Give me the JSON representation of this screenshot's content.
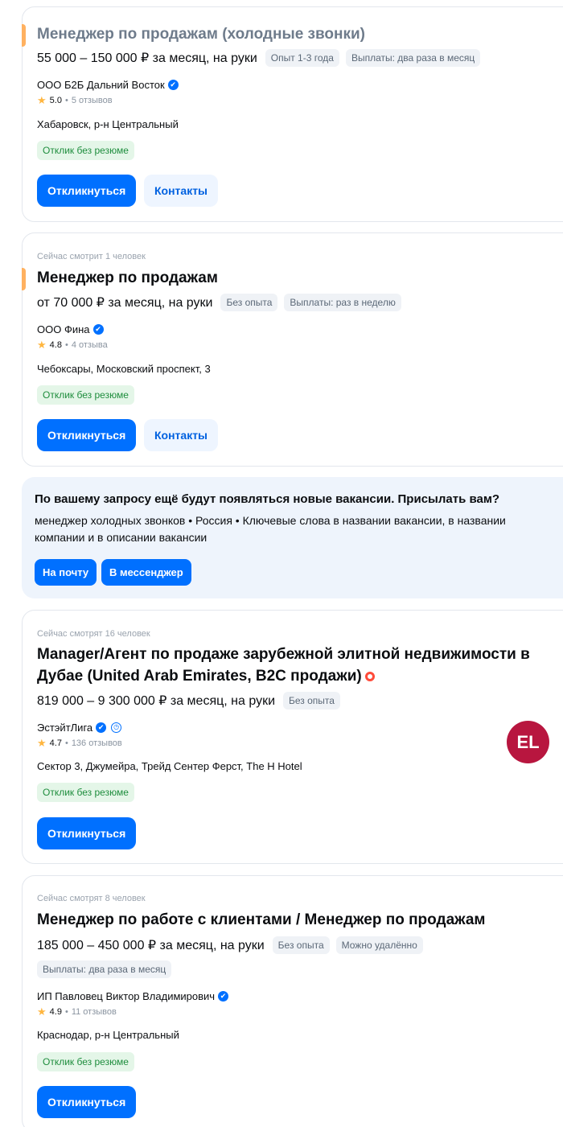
{
  "vacancies": [
    {
      "watching": "",
      "title": "Менеджер по продажам (холодные звонки)",
      "salary": "55 000 – 150 000 ₽ за месяц, на руки",
      "tags": [
        "Опыт 1-3 года",
        "Выплаты: два раза в месяц"
      ],
      "company": "ООО Б2Б Дальний Восток",
      "rating": "5.0",
      "reviews": "5 отзывов",
      "location": "Хабаровск, р-н Центральный",
      "badge": "Отклик без резюме",
      "apply_label": "Откликнуться",
      "contacts_label": "Контакты"
    },
    {
      "watching": "Сейчас смотрит 1 человек",
      "title": "Менеджер по продажам",
      "salary": "от 70 000 ₽ за месяц, на руки",
      "tags": [
        "Без опыта",
        "Выплаты: раз в неделю"
      ],
      "company": "ООО Фина",
      "rating": "4.8",
      "reviews": "4 отзыва",
      "location": "Чебоксары, Московский проспект, 3",
      "badge": "Отклик без резюме",
      "apply_label": "Откликнуться",
      "contacts_label": "Контакты"
    },
    {
      "watching": "Сейчас смотрят 16 человек",
      "title": "Manager/Агент по продаже зарубежной элитной недвижимости в Дубае (United Arab Emirates, B2C продажи)",
      "salary": "819 000 – 9 300 000 ₽ за месяц, на руки",
      "tags": [
        "Без опыта"
      ],
      "company": "ЭстэйтЛига",
      "rating": "4.7",
      "reviews": "136 отзывов",
      "location": "Сектор 3, Джумейра, Трейд Сентер Ферст, The H Hotel",
      "badge": "Отклик без резюме",
      "apply_label": "Откликнуться",
      "logo_text": "EL"
    },
    {
      "watching": "Сейчас смотрят 8 человек",
      "title": "Менеджер по работе с клиентами / Менеджер по продажам",
      "salary": "185 000 – 450 000 ₽ за месяц, на руки",
      "tags": [
        "Без опыта",
        "Можно удалённо"
      ],
      "tags2": [
        "Выплаты: два раза в месяц"
      ],
      "company": "ИП Павловец Виктор Владимирович",
      "rating": "4.9",
      "reviews": "11 отзывов",
      "location": "Краснодар, р-н Центральный",
      "badge": "Отклик без резюме",
      "apply_label": "Откликнуться"
    }
  ],
  "subscribe": {
    "title": "По вашему запросу ещё будут появляться новые вакансии. Присылать вам?",
    "description": "менеджер холодных звонков • Россия • Ключевые слова в названии вакансии, в названии компании и в описании вакансии",
    "email_label": "На почту",
    "messenger_label": "В мессенджер"
  },
  "icons": {
    "verified": "✔",
    "star": "★",
    "separator": "•"
  },
  "colors": {
    "primary": "#0070ff",
    "accent": "#ffb160",
    "success": "#1e8d3d",
    "logo_bg": "#b8163f"
  }
}
